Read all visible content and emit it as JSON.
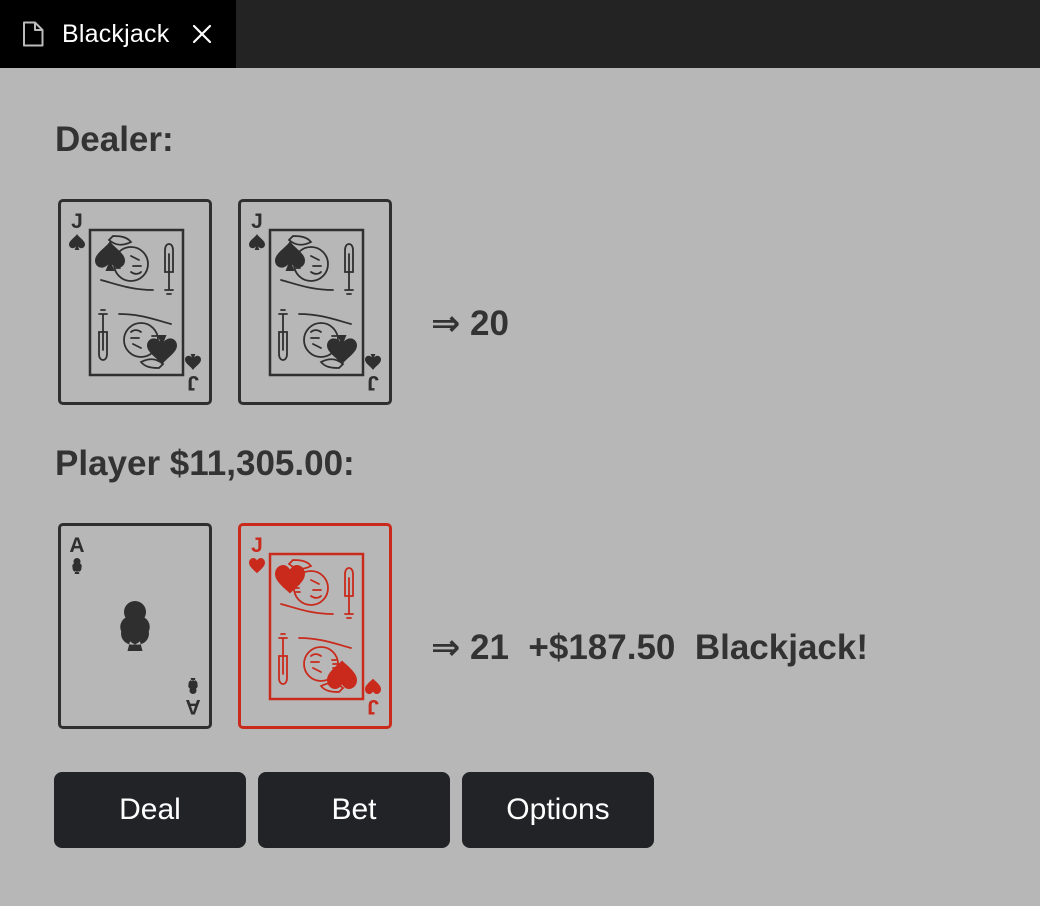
{
  "tab": {
    "title": "Blackjack",
    "file_icon": "file-icon",
    "close_icon": "close-icon"
  },
  "dealer": {
    "heading": "Dealer:",
    "cards": [
      {
        "rank": "J",
        "suit": "spade",
        "color": "#2f2f2f"
      },
      {
        "rank": "J",
        "suit": "spade",
        "color": "#2f2f2f"
      }
    ],
    "total_text": "⇒ 20"
  },
  "player": {
    "heading": "Player $11,305.00:",
    "cards": [
      {
        "rank": "A",
        "suit": "club",
        "color": "#2f2f2f"
      },
      {
        "rank": "J",
        "suit": "heart",
        "color": "#c92a1b"
      }
    ],
    "total_text": "⇒ 21  +$187.50  Blackjack!"
  },
  "buttons": {
    "deal": "Deal",
    "bet": "Bet",
    "options": "Options"
  },
  "colors": {
    "background": "#b7b7b7",
    "button": "#222327",
    "text": "#333333",
    "red_suit": "#c92a1b"
  }
}
